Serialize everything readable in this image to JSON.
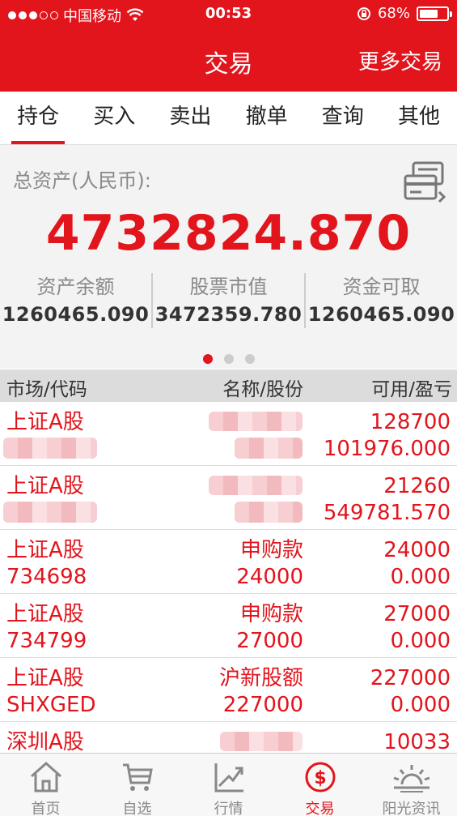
{
  "status_bar": {
    "carrier": "中国移动",
    "time": "00:53",
    "battery": "68%",
    "battery_level": 0.68
  },
  "header": {
    "title": "交易",
    "more": "更多交易"
  },
  "tabs": [
    {
      "label": "持仓",
      "active": true
    },
    {
      "label": "买入"
    },
    {
      "label": "卖出"
    },
    {
      "label": "撤单"
    },
    {
      "label": "查询"
    },
    {
      "label": "其他"
    }
  ],
  "assets": {
    "label": "总资产(人民币):",
    "total": "4732824.870",
    "columns": [
      {
        "label": "资产余额",
        "value": "1260465.090"
      },
      {
        "label": "股票市值",
        "value": "3472359.780"
      },
      {
        "label": "资金可取",
        "value": "1260465.090"
      }
    ],
    "page_index": 1,
    "page_count": 3
  },
  "table": {
    "headers": [
      "市场/代码",
      "名称/股份",
      "可用/盈亏"
    ],
    "rows": [
      {
        "market": "上证A股",
        "code": "",
        "name": "",
        "shares": "",
        "available": "128700",
        "pnl": "101976.000",
        "redacted": true
      },
      {
        "market": "上证A股",
        "code": "",
        "name": "",
        "shares": "",
        "available": "21260",
        "pnl": "549781.570",
        "redacted": true
      },
      {
        "market": "上证A股",
        "code": "734698",
        "name": "申购款",
        "shares": "24000",
        "available": "24000",
        "pnl": "0.000"
      },
      {
        "market": "上证A股",
        "code": "734799",
        "name": "申购款",
        "shares": "27000",
        "available": "27000",
        "pnl": "0.000"
      },
      {
        "market": "上证A股",
        "code": "SHXGED",
        "name": "沪新股额",
        "shares": "227000",
        "available": "227000",
        "pnl": "0.000"
      },
      {
        "market": "深圳A股",
        "code": "",
        "name": "",
        "shares": "",
        "available": "10033",
        "pnl": "",
        "redacted": true
      }
    ]
  },
  "bottom_nav": [
    {
      "label": "首页",
      "icon": "home-icon"
    },
    {
      "label": "自选",
      "icon": "cart-icon"
    },
    {
      "label": "行情",
      "icon": "trend-icon"
    },
    {
      "label": "交易",
      "icon": "dollar-icon",
      "active": true
    },
    {
      "label": "阳光资讯",
      "icon": "sun-news-icon"
    }
  ],
  "colors": {
    "brand": "#e2141c",
    "inactive": "#888888"
  }
}
